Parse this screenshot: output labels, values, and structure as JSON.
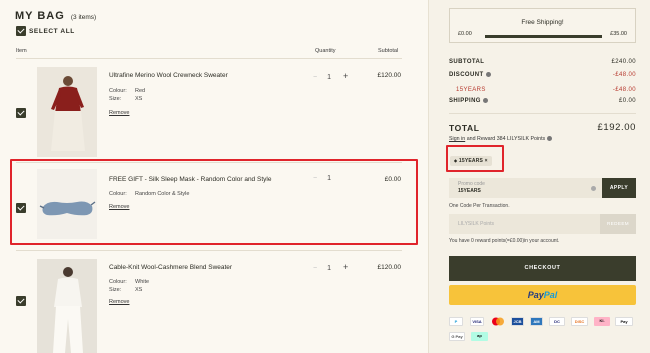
{
  "bag": {
    "title": "MY BAG",
    "count": "(3 items)",
    "select_all": "SELECT ALL"
  },
  "columns": {
    "item": "Item",
    "quantity": "Quantity",
    "subtotal": "Subtotal"
  },
  "items": [
    {
      "name": "Ultrafine Merino Wool Crewneck Sweater",
      "colour_label": "Colour:",
      "colour": "Red",
      "size_label": "Size:",
      "size": "XS",
      "remove": "Remove",
      "minus": "−",
      "qty": "1",
      "plus": "+",
      "price": "£120.00"
    },
    {
      "name": "FREE GIFT - Silk Sleep Mask - Random Color and Style",
      "colour_label": "Colour:",
      "colour": "Random Color & Style",
      "remove": "Remove",
      "minus": "−",
      "qty": "1",
      "price": "£0.00"
    },
    {
      "name": "Cable-Knit Wool-Cashmere Blend Sweater",
      "colour_label": "Colour:",
      "colour": "White",
      "size_label": "Size:",
      "size": "XS",
      "remove": "Remove",
      "minus": "−",
      "qty": "1",
      "plus": "+",
      "price": "£120.00"
    }
  ],
  "shipping_progress": {
    "title": "Free Shipping!",
    "start": "£0.00",
    "end": "£35.00",
    "progress": 1.0
  },
  "summary": {
    "subtotal_label": "SUBTOTAL",
    "subtotal": "£240.00",
    "discount_label": "DISCOUNT",
    "discount": "-£48.00",
    "code_label": "15YEARS",
    "code_amount": "-£48.00",
    "shipping_label": "SHIPPING",
    "shipping": "£0.00",
    "total_label": "TOTAL",
    "total": "£192.00",
    "sign_in": "Sign in",
    "reward_text": "and Reward 384 LILYSILK Points"
  },
  "promo": {
    "applied_tag": "15YEARS",
    "tag_close": "×",
    "label": "Promo code",
    "value": "15YEARS",
    "apply": "APPLY",
    "note": "One Code Per Transaction."
  },
  "points": {
    "placeholder": "LILYSILK Points",
    "redeem": "REDEEM",
    "note": "You have 0 reward points(=£0.00)in your account."
  },
  "checkout": {
    "label": "CHECKOUT"
  },
  "paypal": {
    "pay": "Pay",
    "pal": "Pal"
  },
  "payment_icons": [
    "PayPal",
    "VISA",
    "Mastercard",
    "JCB",
    "Amex",
    "Diners Club",
    "DISCOVER",
    "Klarna",
    "Apple Pay",
    "Google Pay",
    "Afterpay"
  ],
  "highlight_color": "#e0242b",
  "accent_color": "#3a3d2c"
}
